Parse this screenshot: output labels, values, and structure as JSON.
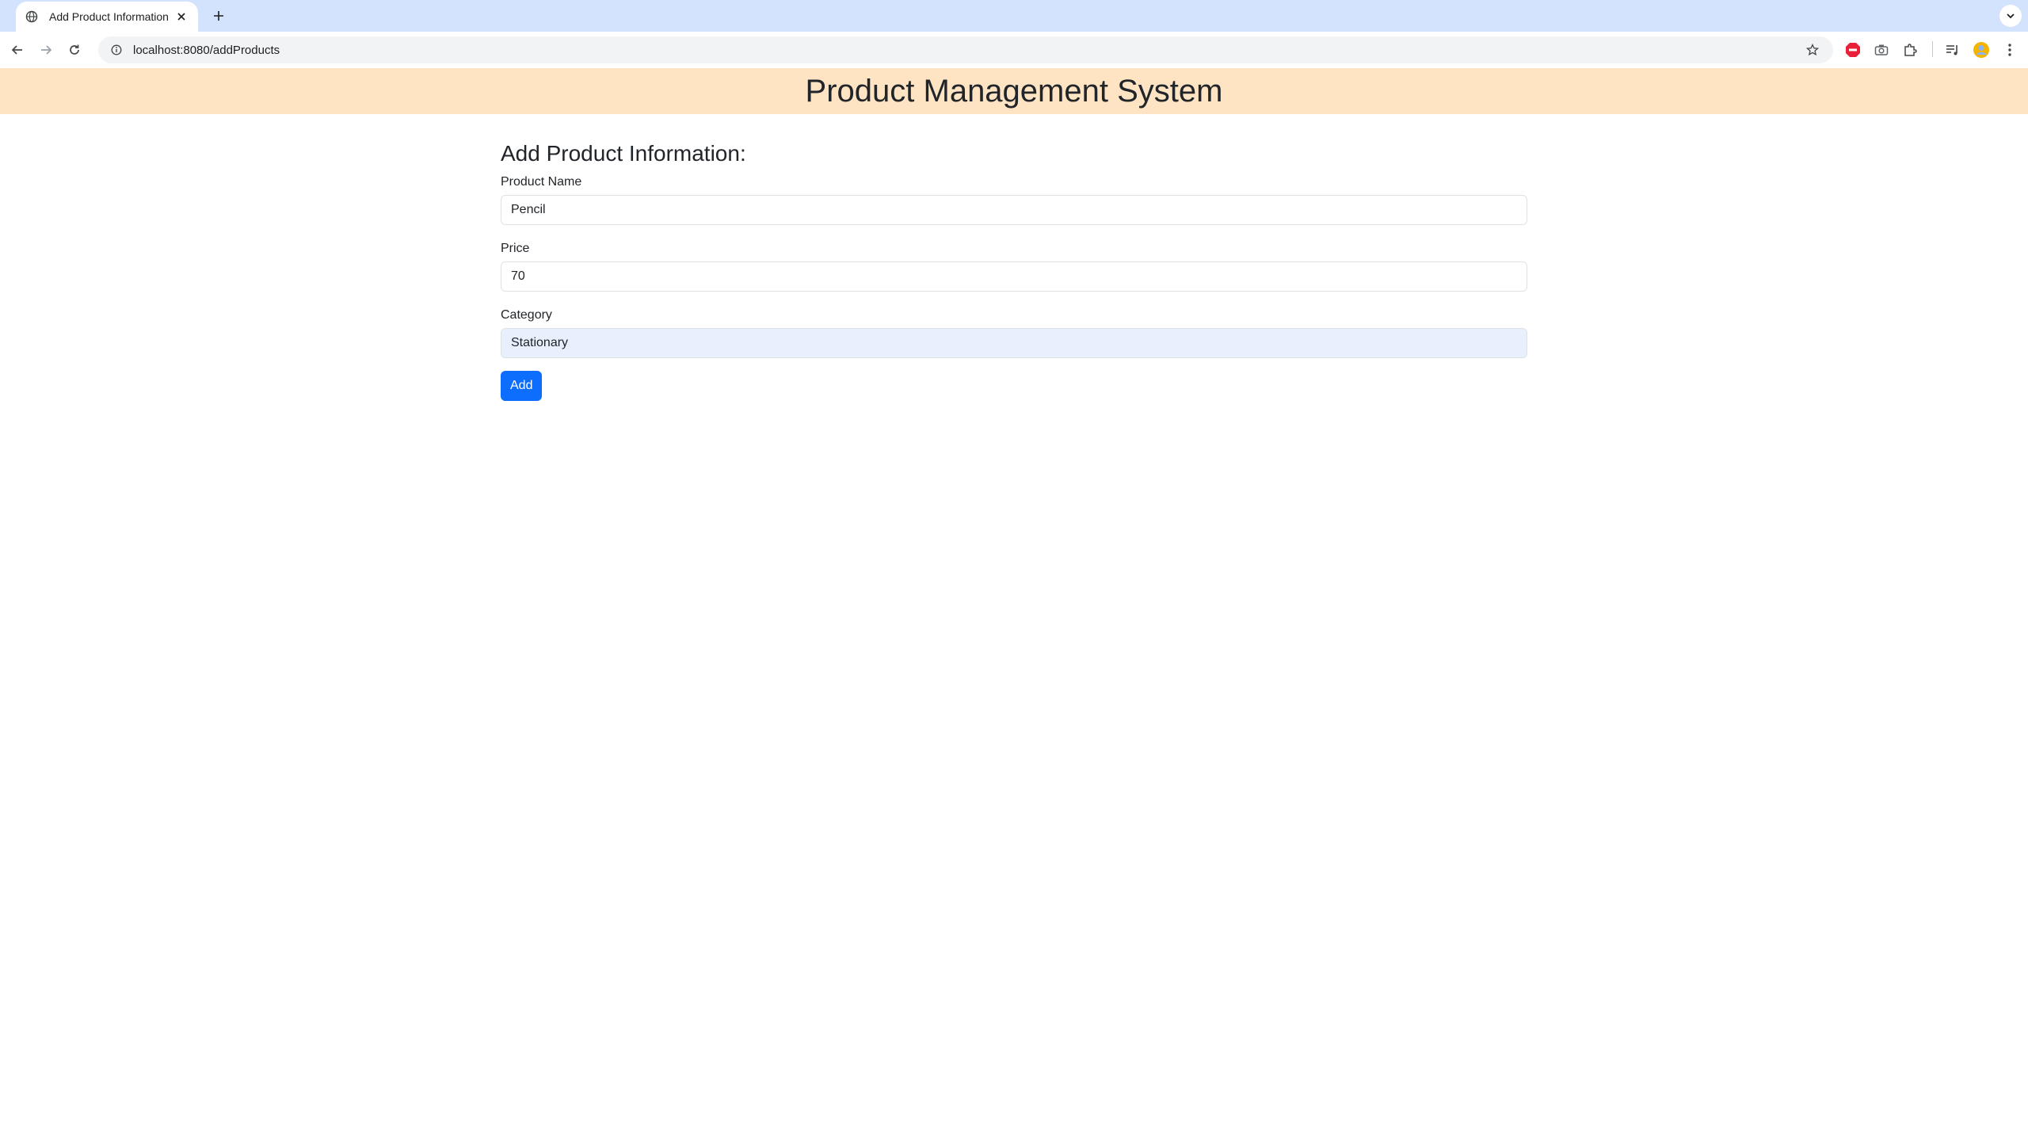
{
  "browser": {
    "tab_title": "Add Product Information",
    "url": "localhost:8080/addProducts"
  },
  "page": {
    "header_title": "Product Management System",
    "form_title": "Add Product Information:"
  },
  "form": {
    "product_name": {
      "label": "Product Name",
      "value": "Pencil"
    },
    "price": {
      "label": "Price",
      "value": "70"
    },
    "category": {
      "label": "Category",
      "value": "Stationary"
    },
    "submit_label": "Add"
  },
  "icons": [
    "globe-icon",
    "close-icon",
    "plus-icon",
    "chevron-down-icon",
    "back-arrow-icon",
    "forward-arrow-icon",
    "reload-icon",
    "site-info-icon",
    "star-icon",
    "adblock-icon",
    "camera-icon",
    "puzzle-icon",
    "media-control-icon",
    "avatar",
    "kebab-menu-icon"
  ],
  "colors": {
    "tabbar": "#d3e3fd",
    "header_bg": "#ffe4c4",
    "primary_button": "#0d6efd",
    "autofill_bg": "#e8f0fe",
    "adblock": "#e8203a"
  }
}
